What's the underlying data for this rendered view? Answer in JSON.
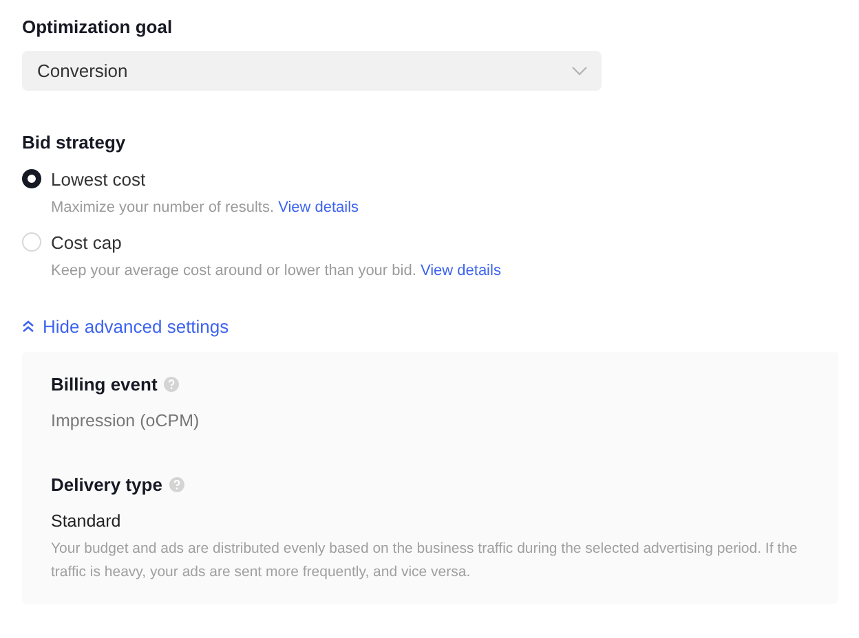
{
  "optimization_goal": {
    "label": "Optimization goal",
    "value": "Conversion"
  },
  "bid_strategy": {
    "label": "Bid strategy",
    "options": [
      {
        "label": "Lowest cost",
        "selected": true,
        "description": "Maximize your number of results.",
        "link": "View details"
      },
      {
        "label": "Cost cap",
        "selected": false,
        "description": "Keep your average cost around or lower than your bid.",
        "link": "View details"
      }
    ]
  },
  "advanced_toggle": {
    "label": "Hide advanced settings",
    "expanded": true
  },
  "advanced": [
    {
      "label": "Billing event",
      "value": "Impression (oCPM)",
      "kind": "muted"
    },
    {
      "label": "Delivery type",
      "value": "Standard",
      "kind": "strong",
      "description": "Your budget and ads are distributed evenly based on the business traffic during the selected advertising period. If the traffic is heavy, your ads are sent more frequently, and vice versa."
    }
  ]
}
